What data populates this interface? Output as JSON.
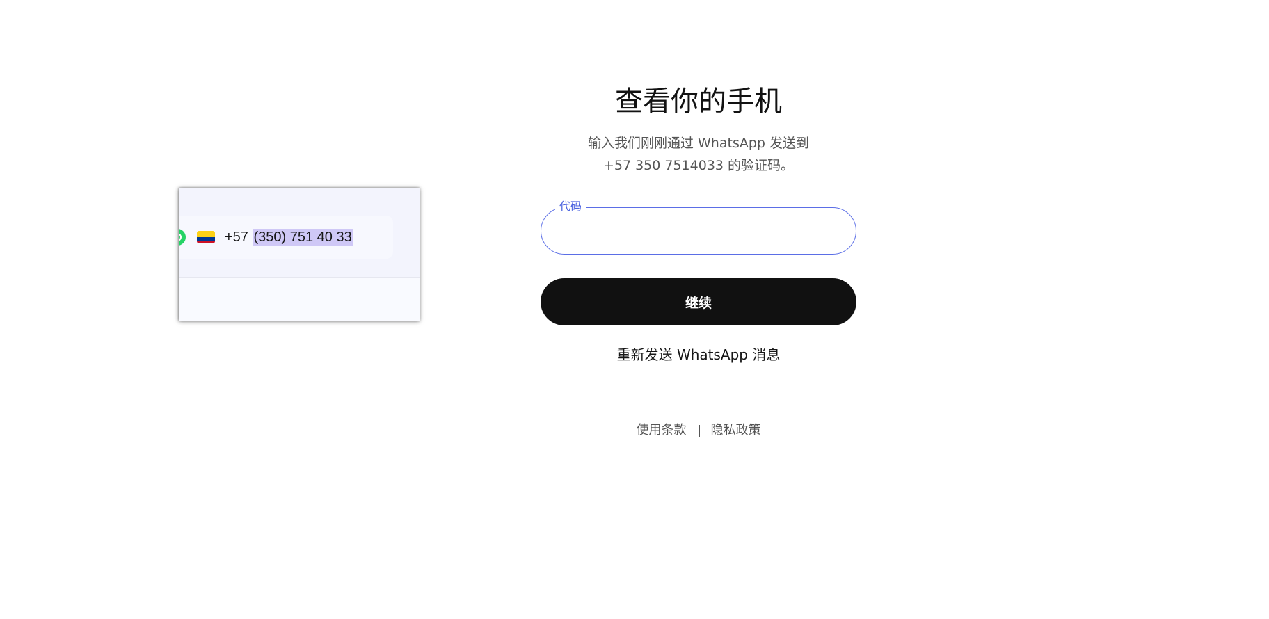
{
  "verify": {
    "title": "查看你的手机",
    "subtitle_line1": "输入我们刚刚通过 WhatsApp 发送到",
    "subtitle_line2": "+57 350 7514033 的验证码。",
    "code_label": "代码",
    "code_value": "",
    "continue_label": "继续",
    "resend_label": "重新发送 WhatsApp 消息"
  },
  "footer": {
    "terms_label": "使用条款",
    "privacy_label": "隐私政策"
  },
  "inset": {
    "country_code": "+57",
    "phone_number": "(350) 751 40 33",
    "flag": "colombia-flag",
    "messenger_icon": "whatsapp-icon"
  },
  "colors": {
    "accent": "#4b63e0",
    "button_bg": "#111111",
    "whatsapp_green": "#25d366",
    "selection_highlight": "#cfc8f6"
  }
}
